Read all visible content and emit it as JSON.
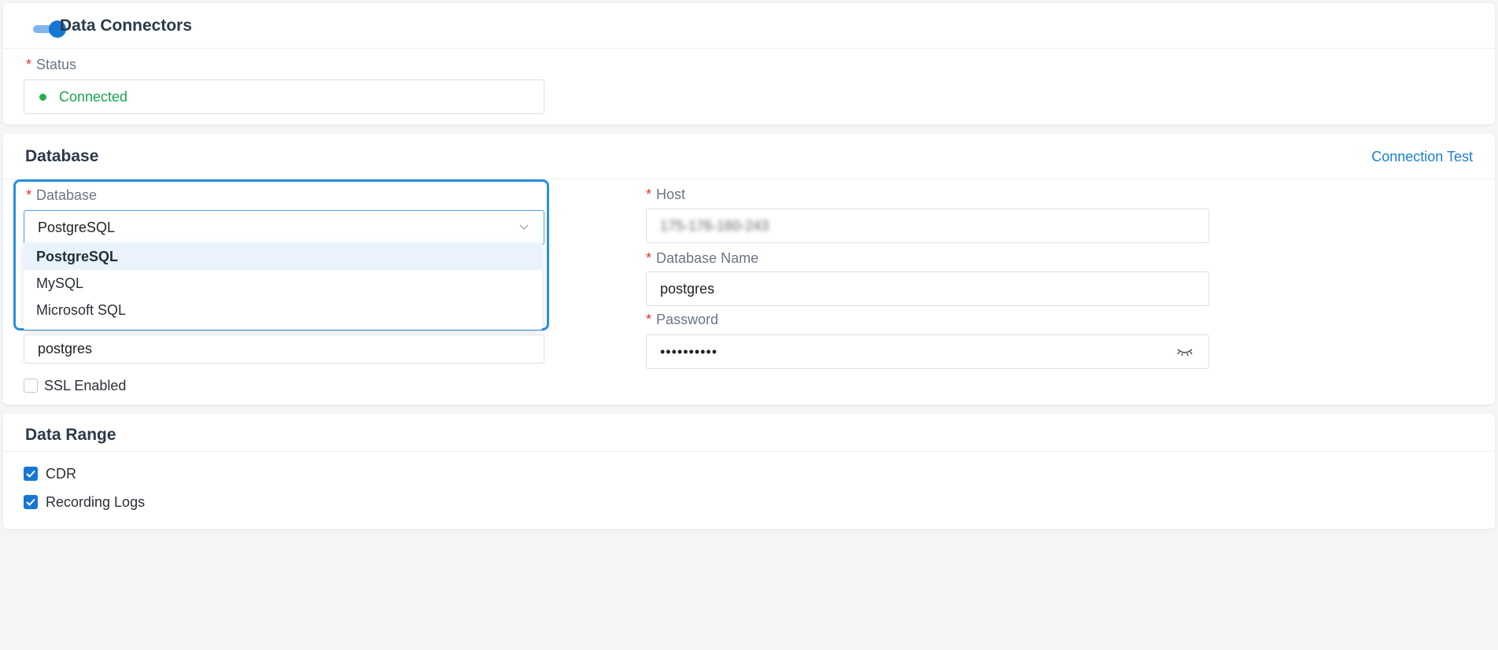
{
  "connectors": {
    "title": "Data Connectors",
    "status_label": "Status",
    "status_value": "Connected",
    "status_color": "#18a64a"
  },
  "database": {
    "title": "Database",
    "connection_test": "Connection Test",
    "db_label": "Database",
    "db_value": "PostgreSQL",
    "options": [
      "PostgreSQL",
      "MySQL",
      "Microsoft SQL"
    ],
    "username_value": "postgres",
    "host_label": "Host",
    "host_value": "175-176-160-243",
    "dbname_label": "Database Name",
    "dbname_value": "postgres",
    "password_label": "Password",
    "password_value": "••••••••••",
    "ssl_label": "SSL Enabled"
  },
  "range": {
    "title": "Data Range",
    "cdr": "CDR",
    "recording_logs": "Recording Logs"
  },
  "colors": {
    "accent": "#1677d2",
    "required": "#e5322d"
  }
}
